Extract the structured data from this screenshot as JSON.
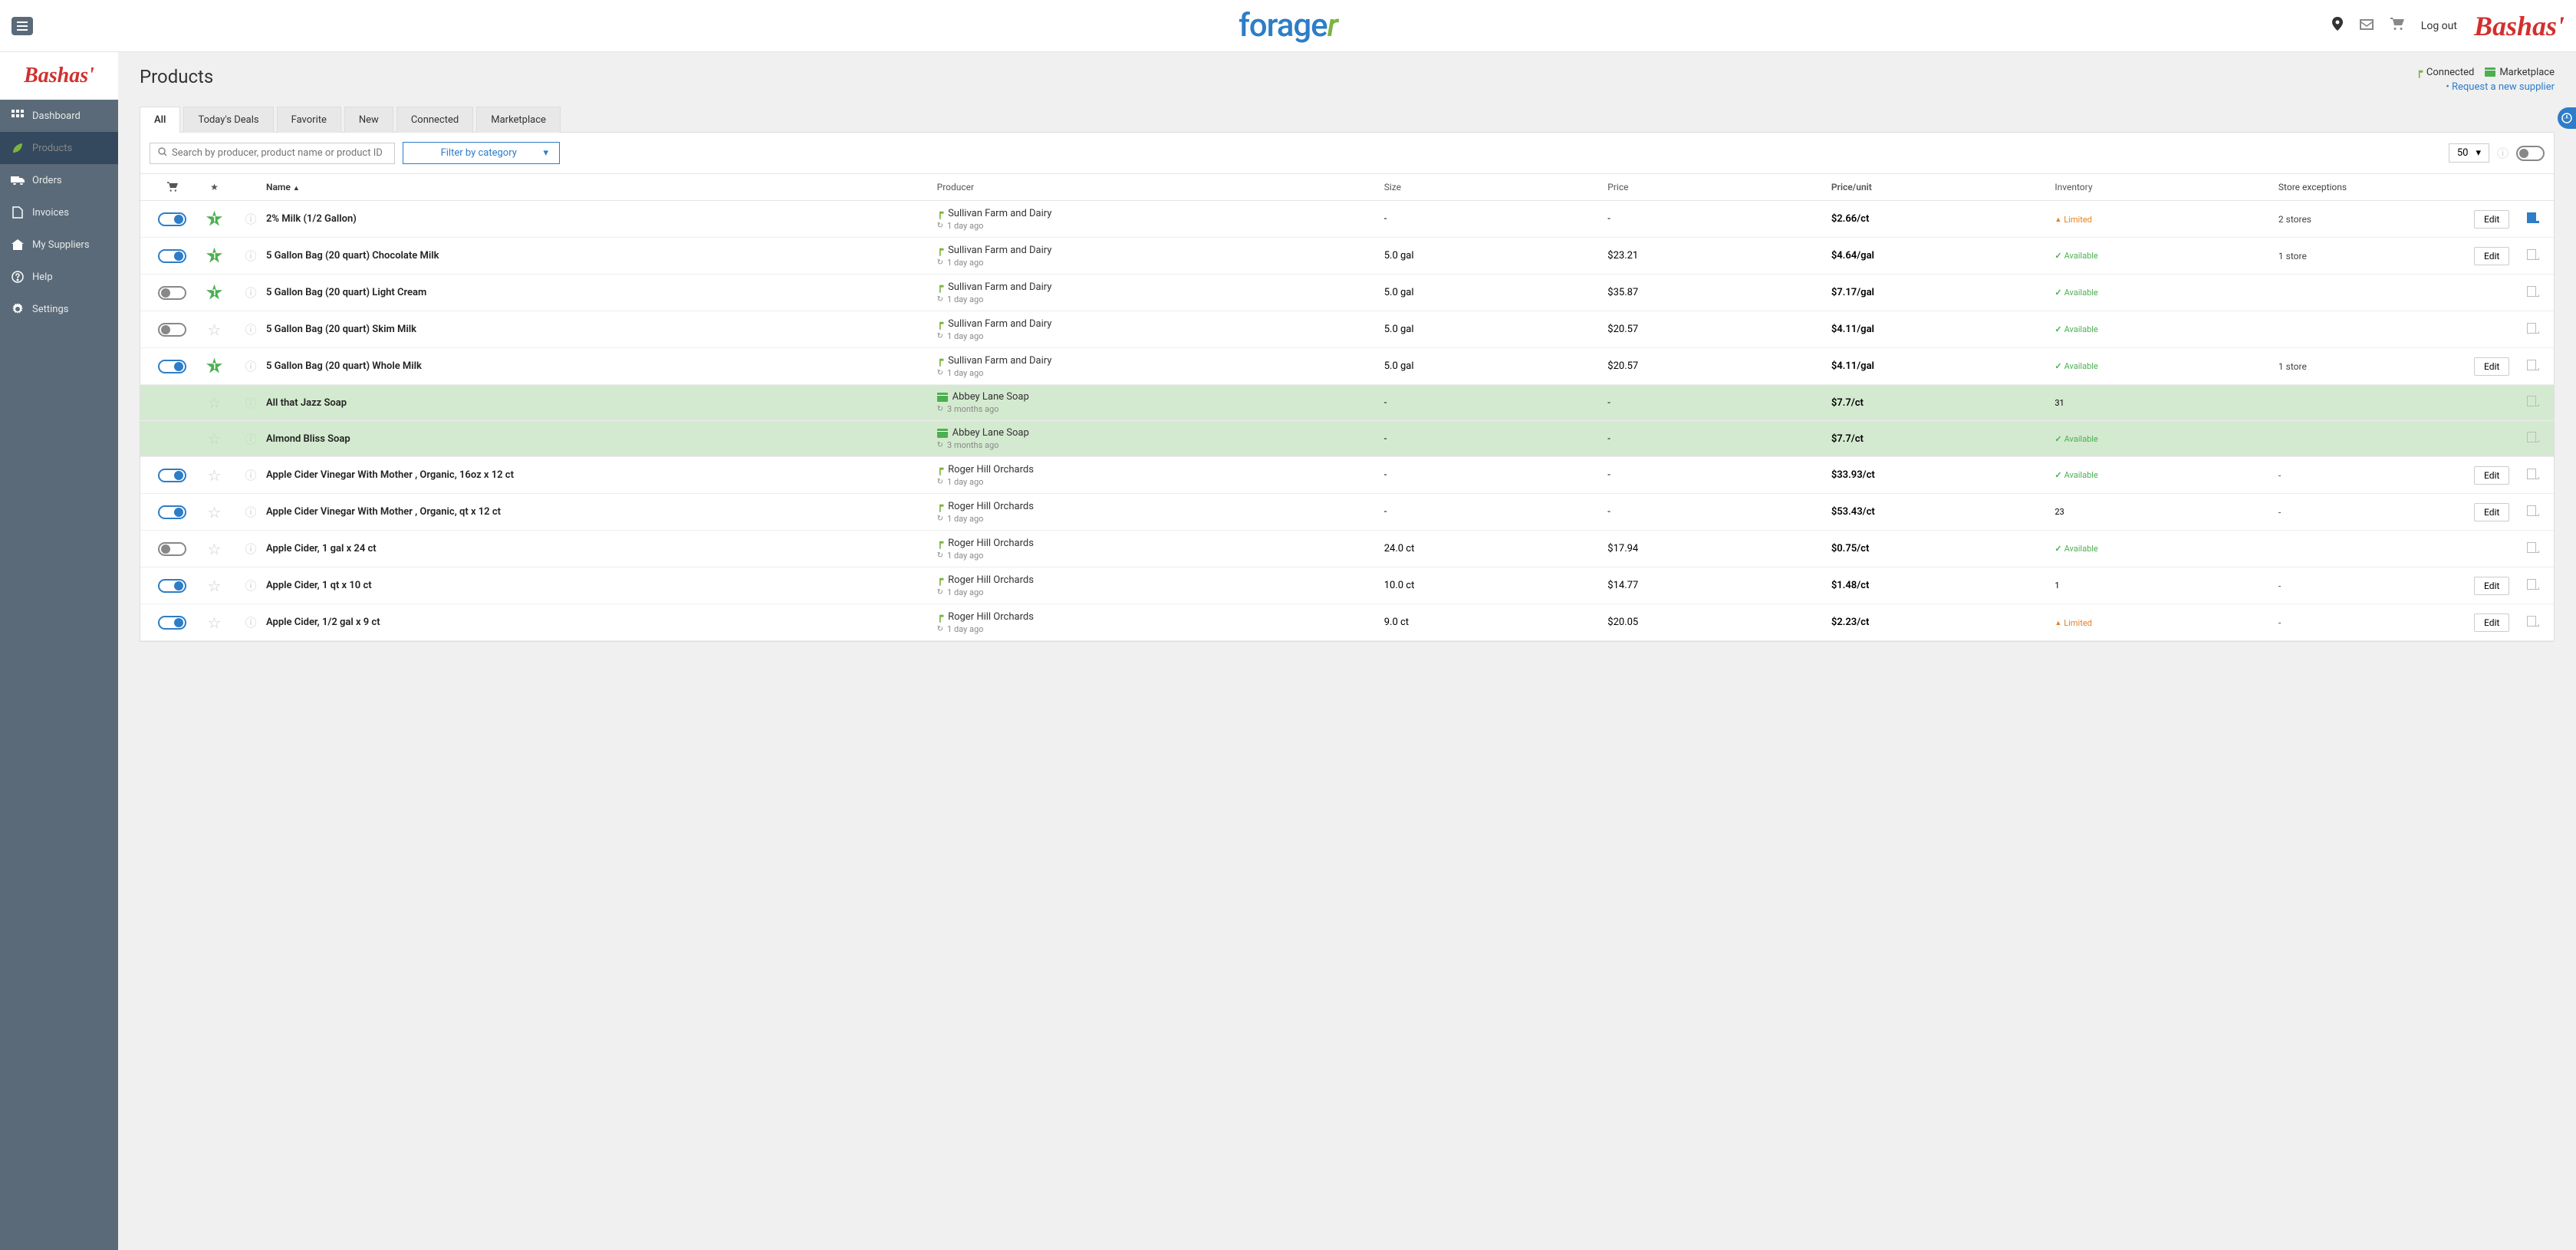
{
  "topbar": {
    "logout": "Log out",
    "brand": "Bashas'"
  },
  "logo": {
    "part1": "forage",
    "part2": "r"
  },
  "sidebar": {
    "brand": "Bashas'",
    "items": [
      {
        "icon": "grid",
        "label": "Dashboard",
        "active": false
      },
      {
        "icon": "leaf",
        "label": "Products",
        "active": true
      },
      {
        "icon": "truck",
        "label": "Orders",
        "active": false
      },
      {
        "icon": "file",
        "label": "Invoices",
        "active": false
      },
      {
        "icon": "home",
        "label": "My Suppliers",
        "active": false
      },
      {
        "icon": "help",
        "label": "Help",
        "active": false
      },
      {
        "icon": "gear",
        "label": "Settings",
        "active": false
      }
    ]
  },
  "page": {
    "title": "Products",
    "legend": {
      "connected": "Connected",
      "marketplace": "Marketplace"
    },
    "request_link": "Request a new supplier"
  },
  "tabs": [
    "All",
    "Today's Deals",
    "Favorite",
    "New",
    "Connected",
    "Marketplace"
  ],
  "active_tab": "All",
  "filters": {
    "search_placeholder": "Search by producer, product name or product ID",
    "category_label": "Filter by category",
    "page_size": "50"
  },
  "columns": {
    "name": "Name",
    "producer": "Producer",
    "size": "Size",
    "price": "Price",
    "price_unit": "Price/unit",
    "inventory": "Inventory",
    "exceptions": "Store exceptions"
  },
  "edit_label": "Edit",
  "inventory_labels": {
    "available": "Available",
    "limited": "Limited"
  },
  "products": [
    {
      "toggle": "on",
      "starred": true,
      "star_count": "1",
      "name": "2% Milk (1/2 Gallon)",
      "producer": "Sullivan Farm and Dairy",
      "producer_type": "connected",
      "updated": "1 day ago",
      "size": "-",
      "price": "-",
      "price_unit": "$2.66/ct",
      "inventory": "limited",
      "exceptions": "2 stores",
      "editable": true,
      "has_doc": true,
      "doc_filled": true,
      "marketplace": false
    },
    {
      "toggle": "on",
      "starred": true,
      "star_count": "1",
      "name": "5 Gallon Bag (20 quart) Chocolate Milk",
      "producer": "Sullivan Farm and Dairy",
      "producer_type": "connected",
      "updated": "1 day ago",
      "size": "5.0 gal",
      "price": "$23.21",
      "price_unit": "$4.64/gal",
      "inventory": "available",
      "exceptions": "1 store",
      "editable": true,
      "has_doc": true,
      "doc_filled": false,
      "marketplace": false
    },
    {
      "toggle": "off",
      "starred": true,
      "star_count": "1",
      "name": "5 Gallon Bag (20 quart) Light Cream",
      "producer": "Sullivan Farm and Dairy",
      "producer_type": "connected",
      "updated": "1 day ago",
      "size": "5.0 gal",
      "price": "$35.87",
      "price_unit": "$7.17/gal",
      "inventory": "available",
      "exceptions": "",
      "editable": false,
      "has_doc": true,
      "doc_filled": false,
      "marketplace": false
    },
    {
      "toggle": "off",
      "starred": false,
      "star_count": "",
      "name": "5 Gallon Bag (20 quart) Skim Milk",
      "producer": "Sullivan Farm and Dairy",
      "producer_type": "connected",
      "updated": "1 day ago",
      "size": "5.0 gal",
      "price": "$20.57",
      "price_unit": "$4.11/gal",
      "inventory": "available",
      "exceptions": "",
      "editable": false,
      "has_doc": true,
      "doc_filled": false,
      "marketplace": false
    },
    {
      "toggle": "on",
      "starred": true,
      "star_count": "1",
      "name": "5 Gallon Bag (20 quart) Whole Milk",
      "producer": "Sullivan Farm and Dairy",
      "producer_type": "connected",
      "updated": "1 day ago",
      "size": "5.0 gal",
      "price": "$20.57",
      "price_unit": "$4.11/gal",
      "inventory": "available",
      "exceptions": "1 store",
      "editable": true,
      "has_doc": true,
      "doc_filled": false,
      "marketplace": false
    },
    {
      "toggle": "",
      "starred": false,
      "star_count": "",
      "name": "All that Jazz Soap",
      "producer": "Abbey Lane Soap",
      "producer_type": "marketplace",
      "updated": "3 months ago",
      "size": "-",
      "price": "-",
      "price_unit": "$7.7/ct",
      "inventory": "31",
      "exceptions": "",
      "editable": false,
      "has_doc": true,
      "doc_filled": false,
      "marketplace": true
    },
    {
      "toggle": "",
      "starred": false,
      "star_count": "",
      "name": "Almond Bliss Soap",
      "producer": "Abbey Lane Soap",
      "producer_type": "marketplace",
      "updated": "3 months ago",
      "size": "-",
      "price": "-",
      "price_unit": "$7.7/ct",
      "inventory": "available",
      "exceptions": "",
      "editable": false,
      "has_doc": true,
      "doc_filled": false,
      "marketplace": true
    },
    {
      "toggle": "on",
      "starred": false,
      "star_count": "",
      "name": "Apple Cider Vinegar With Mother , Organic, 16oz x 12 ct",
      "producer": "Roger Hill Orchards",
      "producer_type": "connected",
      "updated": "1 day ago",
      "size": "-",
      "price": "-",
      "price_unit": "$33.93/ct",
      "inventory": "available",
      "exceptions": "-",
      "editable": true,
      "has_doc": true,
      "doc_filled": false,
      "marketplace": false
    },
    {
      "toggle": "on",
      "starred": false,
      "star_count": "",
      "name": "Apple Cider Vinegar With Mother , Organic, qt x 12 ct",
      "producer": "Roger Hill Orchards",
      "producer_type": "connected",
      "updated": "1 day ago",
      "size": "-",
      "price": "-",
      "price_unit": "$53.43/ct",
      "inventory": "23",
      "exceptions": "-",
      "editable": true,
      "has_doc": true,
      "doc_filled": false,
      "marketplace": false
    },
    {
      "toggle": "off",
      "starred": false,
      "star_count": "",
      "name": "Apple Cider, 1 gal x 24 ct",
      "producer": "Roger Hill Orchards",
      "producer_type": "connected",
      "updated": "1 day ago",
      "size": "24.0 ct",
      "price": "$17.94",
      "price_unit": "$0.75/ct",
      "inventory": "available",
      "exceptions": "",
      "editable": false,
      "has_doc": true,
      "doc_filled": false,
      "marketplace": false
    },
    {
      "toggle": "on",
      "starred": false,
      "star_count": "",
      "name": "Apple Cider, 1 qt x 10 ct",
      "producer": "Roger Hill Orchards",
      "producer_type": "connected",
      "updated": "1 day ago",
      "size": "10.0 ct",
      "price": "$14.77",
      "price_unit": "$1.48/ct",
      "inventory": "1",
      "exceptions": "-",
      "editable": true,
      "has_doc": true,
      "doc_filled": false,
      "marketplace": false
    },
    {
      "toggle": "on",
      "starred": false,
      "star_count": "",
      "name": "Apple Cider, 1/2 gal x 9 ct",
      "producer": "Roger Hill Orchards",
      "producer_type": "connected",
      "updated": "1 day ago",
      "size": "9.0 ct",
      "price": "$20.05",
      "price_unit": "$2.23/ct",
      "inventory": "limited",
      "exceptions": "-",
      "editable": true,
      "has_doc": true,
      "doc_filled": false,
      "marketplace": false
    }
  ]
}
